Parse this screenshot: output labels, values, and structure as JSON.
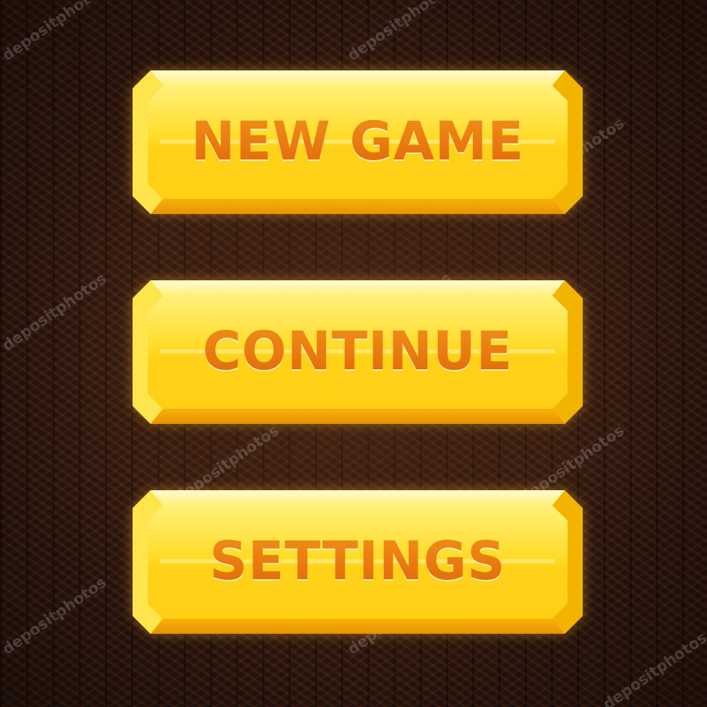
{
  "menu": {
    "buttons": [
      {
        "label": "NEW GAME"
      },
      {
        "label": "CONTINUE"
      },
      {
        "label": "SETTINGS"
      }
    ]
  },
  "watermark": {
    "text": "depositphotos"
  },
  "colors": {
    "background": "#331b12",
    "button_gold": "#ffd21a",
    "button_highlight": "#fff6a0",
    "button_edge": "#e2a500",
    "label_orange": "#e2700f"
  }
}
